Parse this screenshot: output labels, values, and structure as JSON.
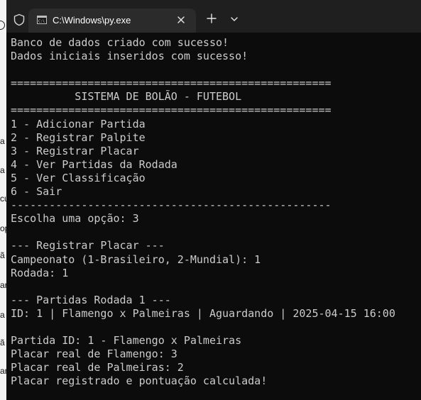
{
  "window": {
    "tab_title": "C:\\Windows\\py.exe",
    "icons": {
      "security": "shield-icon",
      "app": "console-app-icon",
      "close": "close-icon",
      "new_tab": "plus-icon",
      "dropdown": "chevron-down-icon"
    }
  },
  "background_fragments": [
    "a",
    "a",
    "cu",
    "op",
    "ã",
    "ar",
    "a",
    "ã",
    "ar"
  ],
  "console": {
    "lines": [
      "Banco de dados criado com sucesso!",
      "Dados iniciais inseridos com sucesso!",
      "",
      "==================================================",
      "          SISTEMA DE BOLÃO - FUTEBOL",
      "==================================================",
      "1 - Adicionar Partida",
      "2 - Registrar Palpite",
      "3 - Registrar Placar",
      "4 - Ver Partidas da Rodada",
      "5 - Ver Classificação",
      "6 - Sair",
      "--------------------------------------------------",
      "Escolha uma opção: 3",
      "",
      "--- Registrar Placar ---",
      "Campeonato (1-Brasileiro, 2-Mundial): 1",
      "Rodada: 1",
      "",
      "--- Partidas Rodada 1 ---",
      "ID: 1 | Flamengo x Palmeiras | Aguardando | 2025-04-15 16:00",
      "",
      "Partida ID: 1 - Flamengo x Palmeiras",
      "Placar real de Flamengo: 3",
      "Placar real de Palmeiras: 2",
      "Placar registrado e pontuação calculada!"
    ]
  },
  "colors": {
    "console_bg": "#0c0c0c",
    "console_fg": "#cccccc",
    "tabbar_bg": "#1f1f1f",
    "active_tab_bg": "#2b2b2b"
  }
}
